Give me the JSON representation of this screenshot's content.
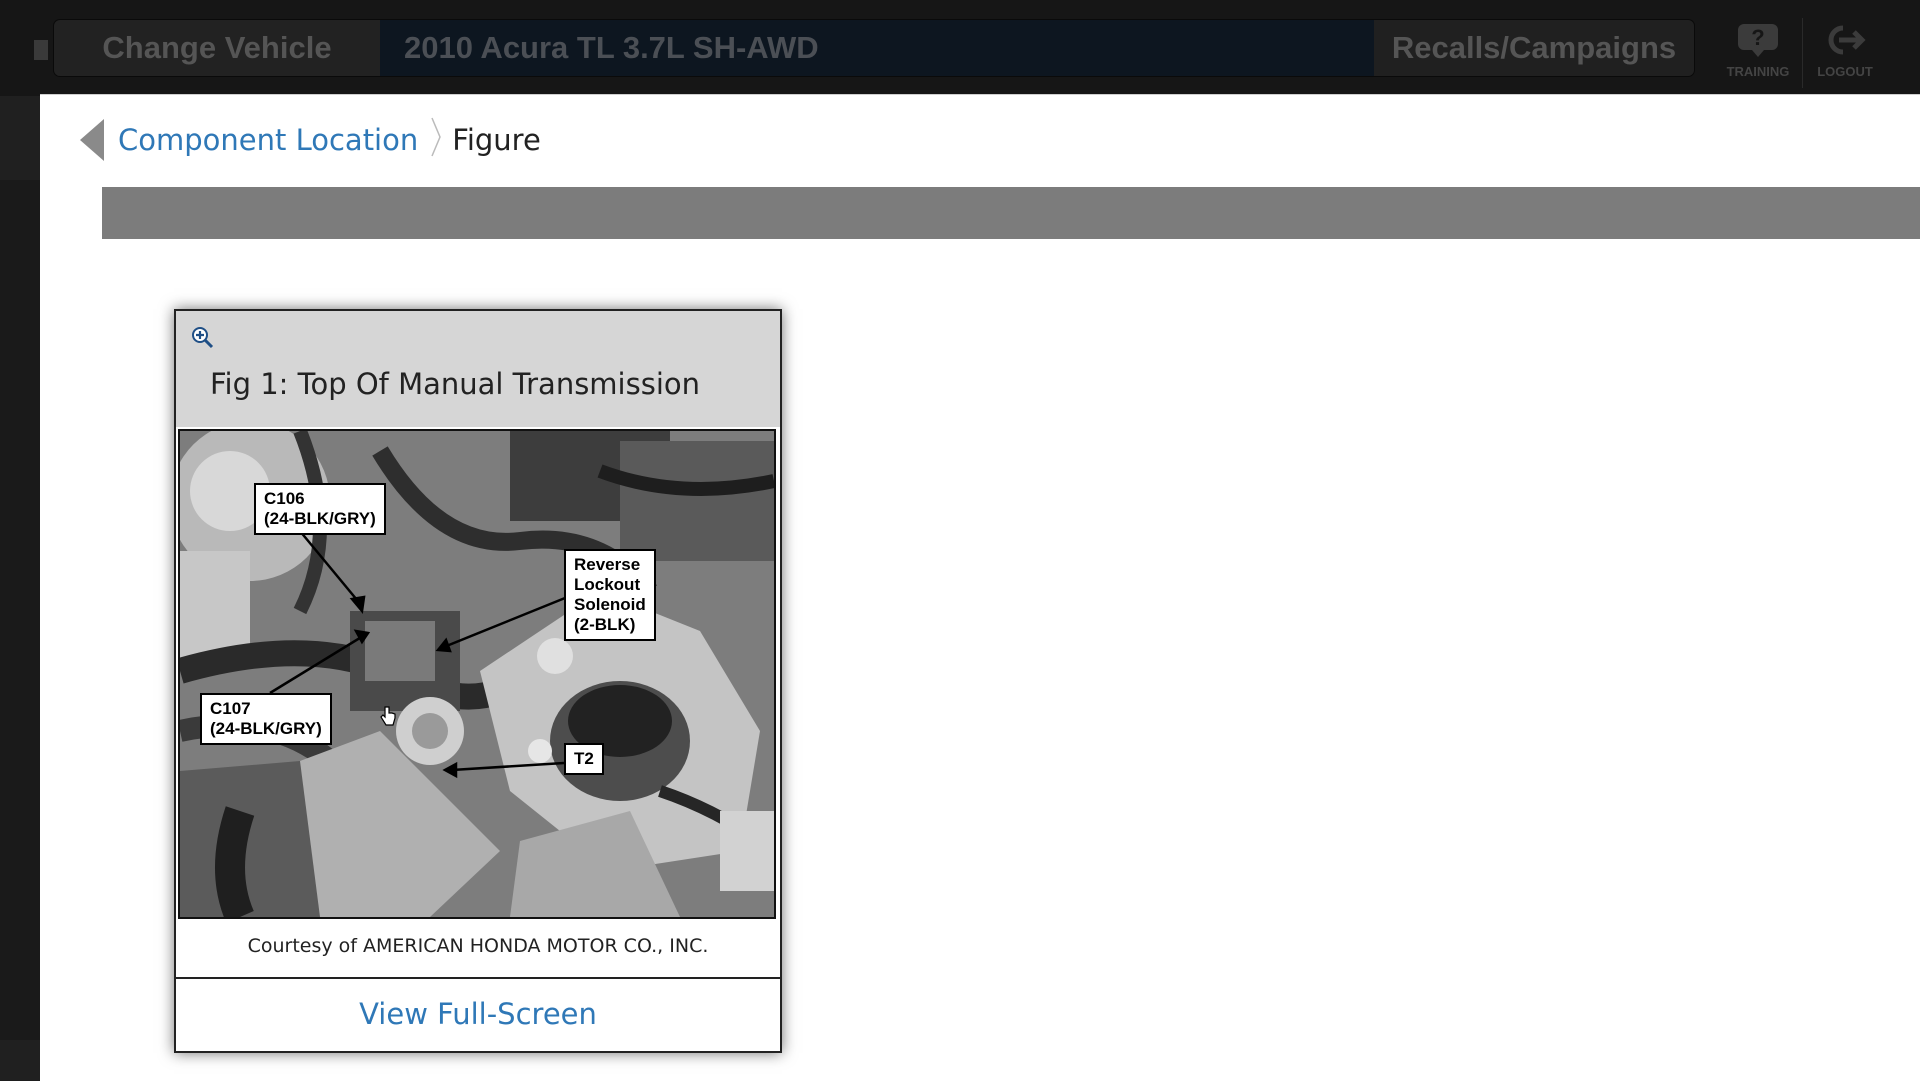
{
  "topbar": {
    "change_vehicle": "Change Vehicle",
    "vehicle": "2010 Acura TL 3.7L SH-AWD",
    "recalls": "Recalls/Campaigns",
    "training_label": "TRAINING",
    "logout_label": "LOGOUT"
  },
  "breadcrumb": {
    "parent": "Component Location",
    "current": "Figure"
  },
  "figure": {
    "title": "Fig 1: Top Of Manual Transmission",
    "callouts": {
      "c106": "C106\n(24-BLK/GRY)",
      "reverse": "Reverse\nLockout\nSolenoid\n(2-BLK)",
      "c107": "C107\n(24-BLK/GRY)",
      "t2": "T2"
    },
    "courtesy": "Courtesy of AMERICAN HONDA MOTOR CO., INC.",
    "view_fullscreen": "View Full-Screen"
  },
  "icons": {
    "back": "chevron-left-icon",
    "zoom": "zoom-in-icon",
    "training": "question-icon",
    "logout": "logout-icon"
  },
  "colors": {
    "link": "#2f78b7",
    "panel_strip": "#7c7c7c",
    "card_header": "#d6d6d6"
  }
}
